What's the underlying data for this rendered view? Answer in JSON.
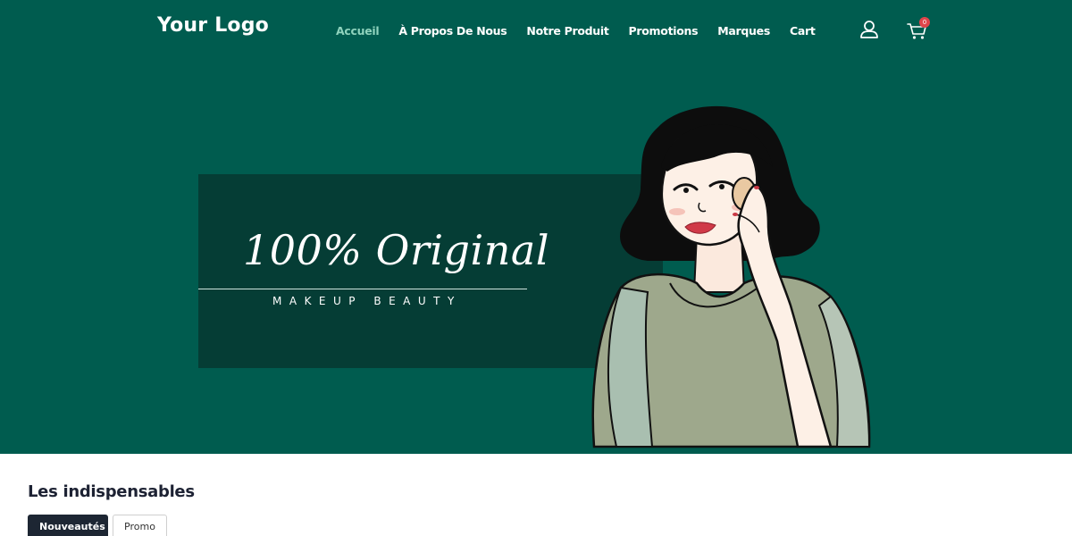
{
  "header": {
    "logo": "Your Logo",
    "nav": [
      {
        "label": "Accueil",
        "active": true
      },
      {
        "label": "À Propos De Nous",
        "active": false
      },
      {
        "label": "Notre Produit",
        "active": false
      },
      {
        "label": "Promotions",
        "active": false
      },
      {
        "label": "Marques",
        "active": false
      },
      {
        "label": "Cart",
        "active": false
      }
    ],
    "icons": {
      "account": "user-icon",
      "cart": "cart-icon"
    },
    "cart_count": "0"
  },
  "hero": {
    "title": "100% Original",
    "subtitle": "MAKEUP BEAUTY",
    "colors": {
      "background": "#005c4f",
      "banner": "#053d35",
      "accent": "#8fd3bd"
    }
  },
  "section": {
    "title": "Les indispensables",
    "tabs": [
      {
        "label": "Nouveautés",
        "active": true
      },
      {
        "label": "Promo",
        "active": false
      }
    ]
  }
}
